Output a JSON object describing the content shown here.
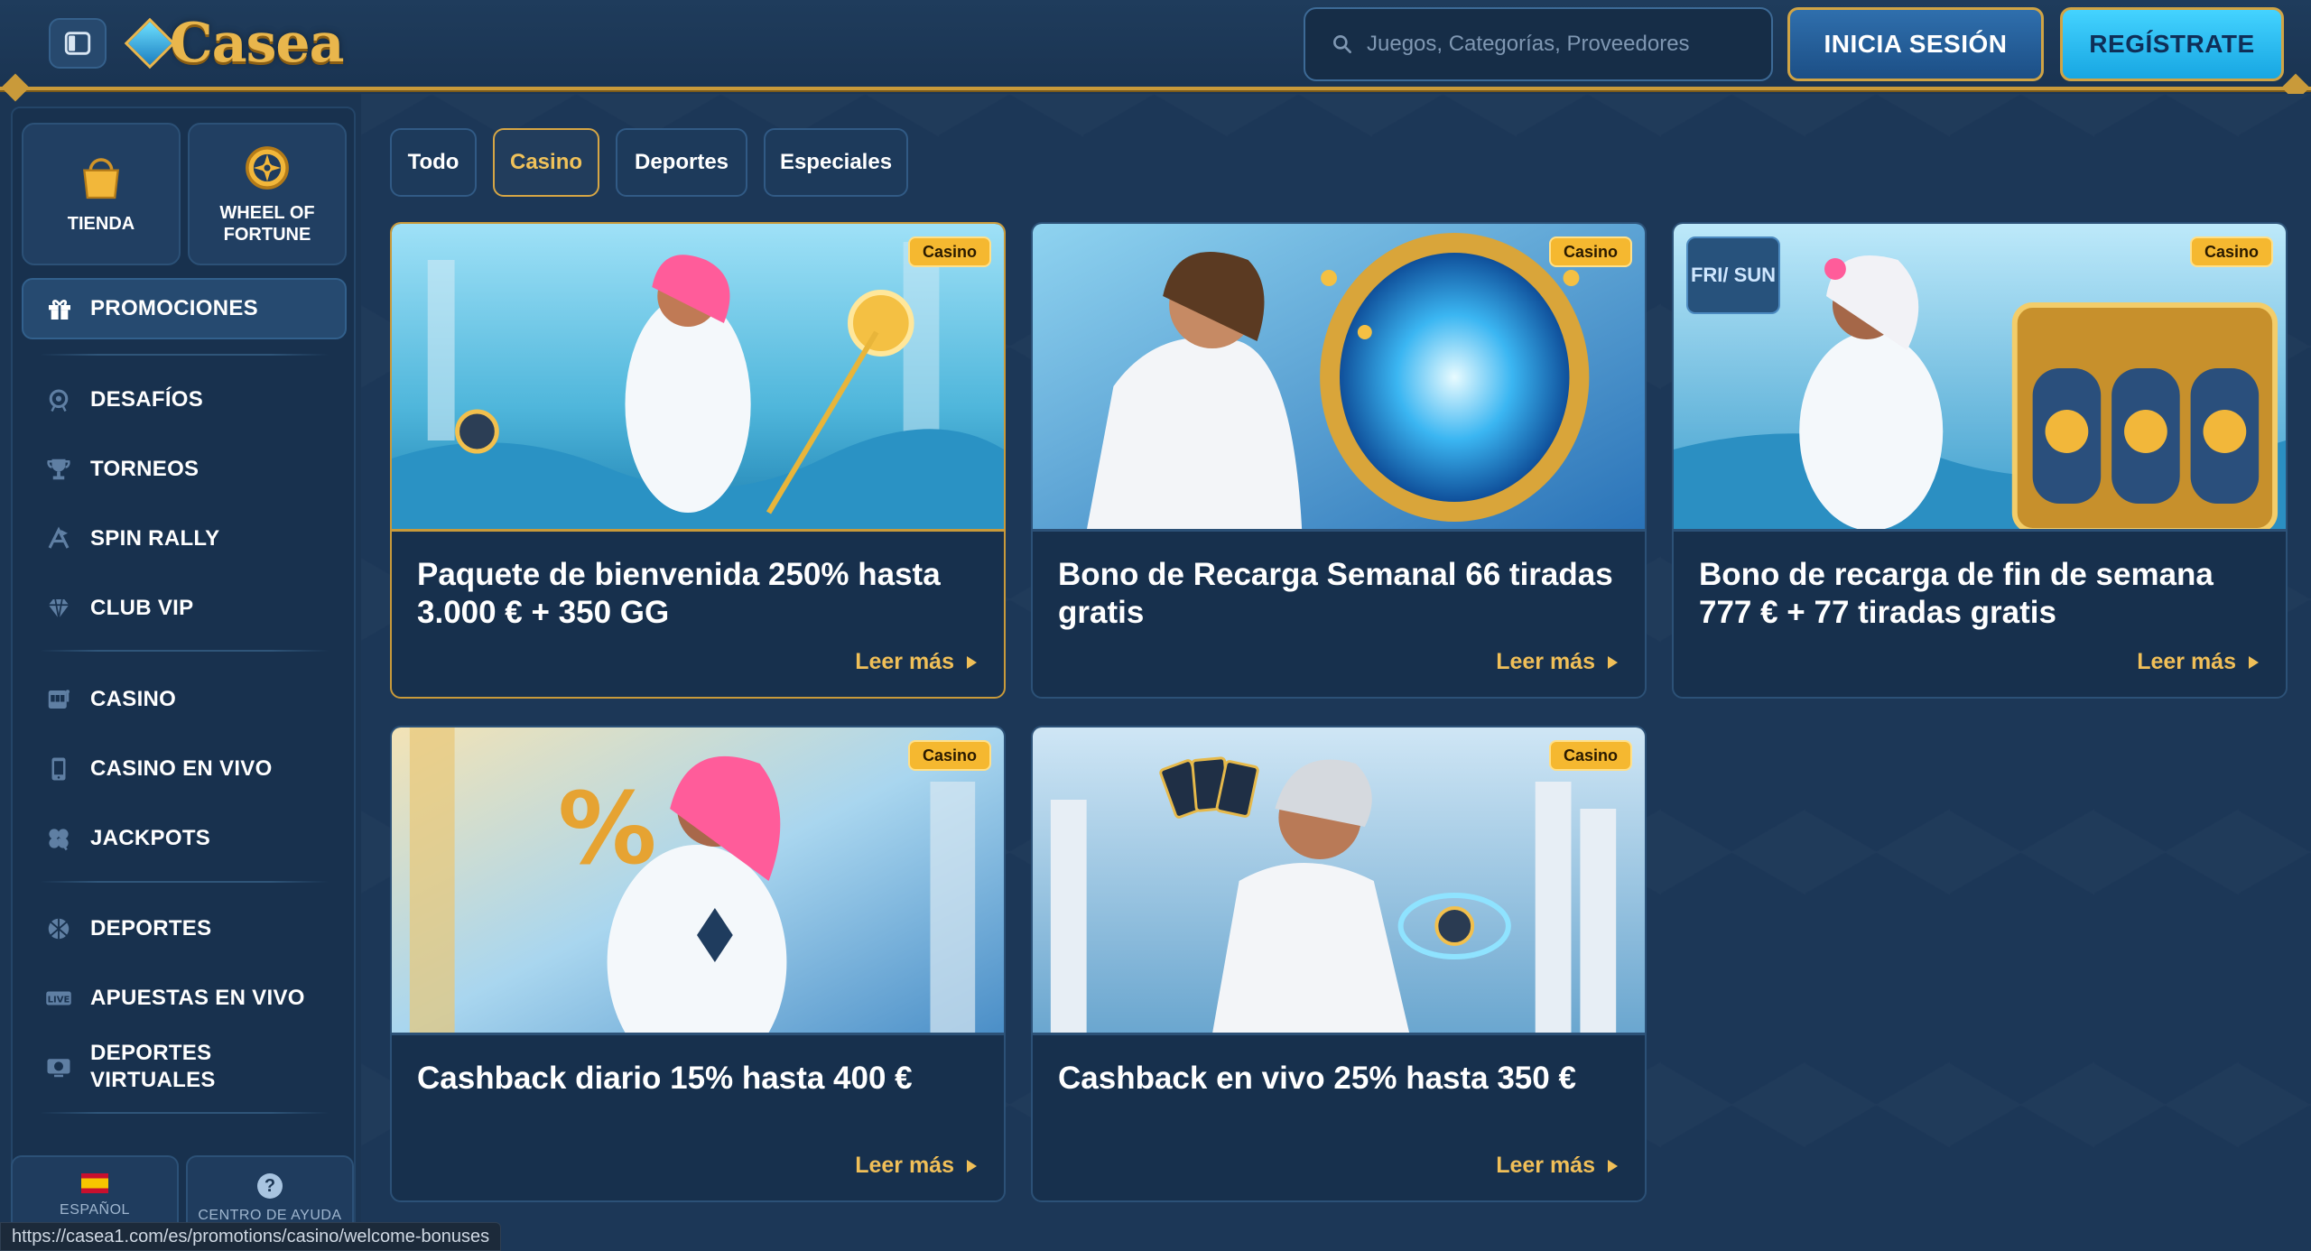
{
  "header": {
    "logo_text": "Casea",
    "search_placeholder": "Juegos, Categorías, Proveedores",
    "login_label": "INICIA SESIÓN",
    "register_label": "REGÍSTRATE"
  },
  "sidebar": {
    "tiles": [
      {
        "label": "TIENDA",
        "icon": "shopping-bag-icon"
      },
      {
        "label": "WHEEL OF FORTUNE",
        "icon": "wheel-icon"
      }
    ],
    "promos_label": "PROMOCIONES",
    "items": [
      {
        "label": "DESAFÍOS",
        "icon": "challenges-icon"
      },
      {
        "label": "TORNEOS",
        "icon": "trophy-icon"
      },
      {
        "label": "SPIN RALLY",
        "icon": "spin-rally-icon"
      },
      {
        "label": "CLUB VIP",
        "icon": "diamond-icon"
      },
      {
        "label": "CASINO",
        "icon": "slot-machine-icon"
      },
      {
        "label": "CASINO EN VIVO",
        "icon": "live-casino-icon"
      },
      {
        "label": "JACKPOTS",
        "icon": "clover-icon"
      },
      {
        "label": "DEPORTES",
        "icon": "ball-icon"
      },
      {
        "label": "APUESTAS EN VIVO",
        "icon": "live-badge-icon"
      },
      {
        "label": "DEPORTES VIRTUALES",
        "icon": "virtual-sports-icon"
      }
    ],
    "footer": {
      "language_label": "ESPAÑOL",
      "help_label": "CENTRO DE AYUDA"
    }
  },
  "filters": {
    "tabs": [
      "Todo",
      "Casino",
      "Deportes",
      "Especiales"
    ],
    "active": "Casino"
  },
  "promotions": [
    {
      "title": "Paquete de bienvenida 250% hasta 3.000 € + 350 GG",
      "badge": "Casino",
      "more": "Leer más",
      "featured": true
    },
    {
      "title": "Bono de Recarga Semanal 66 tiradas gratis",
      "badge": "Casino",
      "more": "Leer más"
    },
    {
      "title": "Bono de recarga de fin de semana 777 € + 77 tiradas gratis",
      "badge": "Casino",
      "more": "Leer más",
      "day_tag": "FRI/ SUN"
    },
    {
      "title": "Cashback diario 15% hasta 400 €",
      "badge": "Casino",
      "more": "Leer más"
    },
    {
      "title": "Cashback en vivo 25% hasta 350 €",
      "badge": "Casino",
      "more": "Leer más"
    }
  ],
  "status_url": "https://casea1.com/es/promotions/casino/welcome-bonuses",
  "colors": {
    "accent_gold": "#c99a3a",
    "bg": "#1b3553",
    "badge": "#f5b830",
    "link": "#f0bf58"
  }
}
